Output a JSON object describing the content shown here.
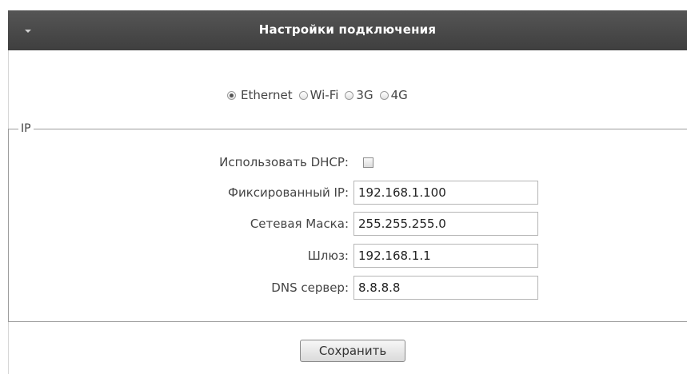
{
  "header": {
    "title": "Настройки подключения"
  },
  "connection_type": {
    "options": [
      {
        "label": "Ethernet",
        "selected": true
      },
      {
        "label": "Wi-Fi",
        "selected": false
      },
      {
        "label": "3G",
        "selected": false
      },
      {
        "label": "4G",
        "selected": false
      }
    ]
  },
  "ip_section": {
    "legend": "IP",
    "dhcp": {
      "label": "Использовать DHCP:",
      "checked": false
    },
    "fixed_ip": {
      "label": "Фиксированный IP:",
      "value": "192.168.1.100"
    },
    "netmask": {
      "label": "Сетевая Маска:",
      "value": "255.255.255.0"
    },
    "gateway": {
      "label": "Шлюз:",
      "value": "192.168.1.1"
    },
    "dns": {
      "label": "DNS сервер:",
      "value": "8.8.8.8"
    }
  },
  "actions": {
    "save_label": "Сохранить"
  }
}
